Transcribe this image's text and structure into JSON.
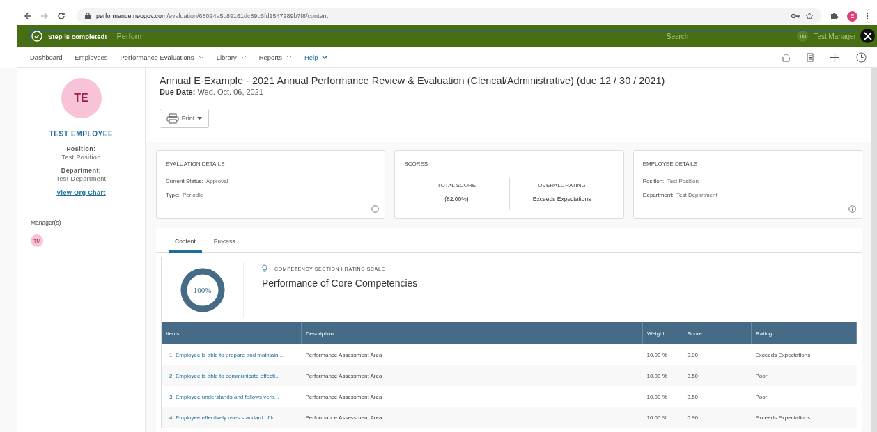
{
  "browser": {
    "url_host": "performance.neogov.com",
    "url_path": "/evaluation/68024a5c89161dc89c6fd1547289b7f8/content",
    "profile_initial": "E"
  },
  "banner": {
    "message": "Step is completed!",
    "behind_app_name": "Perform",
    "behind_search": "Search",
    "behind_user_initials": "TM",
    "behind_user_name": "Test Manager"
  },
  "nav": [
    {
      "label": "Dashboard",
      "dropdown": false,
      "selected": false
    },
    {
      "label": "Employees",
      "dropdown": false,
      "selected": false
    },
    {
      "label": "Performance Evaluations",
      "dropdown": true,
      "selected": false
    },
    {
      "label": "Library",
      "dropdown": true,
      "selected": false
    },
    {
      "label": "Reports",
      "dropdown": true,
      "selected": false
    },
    {
      "label": "Help",
      "dropdown": true,
      "selected": true
    }
  ],
  "employee": {
    "initials": "TE",
    "name": "TEST EMPLOYEE",
    "position_label": "Position:",
    "position": "Test Position",
    "department_label": "Department:",
    "department": "Test Department",
    "org_chart_link": "View Org Chart",
    "managers_label": "Manager(s)",
    "manager_initials": "TM"
  },
  "evaluation": {
    "title": "Annual E-Example - 2021 Annual Performance Review & Evaluation (Clerical/Administrative) (due 12 / 30 / 2021)",
    "due_label": "Due Date:",
    "due_date": "Wed. Oct. 06, 2021",
    "print_button": "Print"
  },
  "evaluation_details": {
    "heading": "EVALUATION DETAILS",
    "fields": [
      {
        "label": "Current Status:",
        "value": "Approval"
      },
      {
        "label": "Type:",
        "value": "Periodic"
      }
    ]
  },
  "scores": {
    "heading": "SCORES",
    "total_label": "TOTAL SCORE",
    "total": "(82.00%)",
    "rating_label": "OVERALL RATING",
    "rating": "Exceeds Expectations"
  },
  "employee_details": {
    "heading": "EMPLOYEE DETAILS",
    "fields": [
      {
        "label": "Position:",
        "value": "Test Position"
      },
      {
        "label": "Department:",
        "value": "Test Department"
      }
    ]
  },
  "tabs": [
    {
      "label": "Content",
      "selected": true
    },
    {
      "label": "Process",
      "selected": false
    }
  ],
  "section": {
    "progress": "100%",
    "level": 1,
    "kicker": "COMPETENCY SECTION I RATING SCALE",
    "title": "Performance of Core Competencies"
  },
  "table": {
    "columns": [
      "Items",
      "Description",
      "Weight",
      "Score",
      "Rating"
    ],
    "rows": [
      [
        "1. Employee is able to prepare and maintain...",
        "Performance Assessment Area",
        "10.00 %",
        "0.90",
        "Exceeds Expectations"
      ],
      [
        "2. Employee is able to communicate effecti...",
        "Performance Assessment Area",
        "10.00 %",
        "0.50",
        "Poor"
      ],
      [
        "3. Employee understands and follows verb...",
        "Performance Assessment Area",
        "10.00 %",
        "0.50",
        "Poor"
      ],
      [
        "4. Employee effectively uses standard offic...",
        "Performance Assessment Area",
        "10.00 %",
        "0.90",
        "Exceeds Expectations"
      ]
    ]
  }
}
